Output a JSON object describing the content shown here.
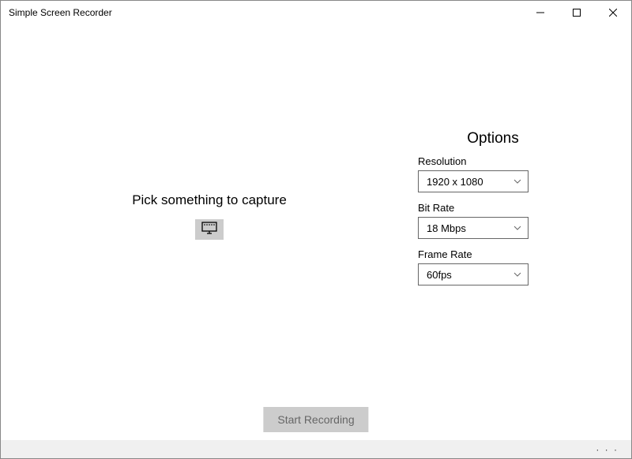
{
  "window": {
    "title": "Simple Screen Recorder"
  },
  "main": {
    "pick_label": "Pick something to capture"
  },
  "options": {
    "heading": "Options",
    "resolution_label": "Resolution",
    "resolution_value": "1920 x 1080",
    "bitrate_label": "Bit Rate",
    "bitrate_value": "18 Mbps",
    "framerate_label": "Frame Rate",
    "framerate_value": "60fps"
  },
  "actions": {
    "start_label": "Start Recording"
  }
}
